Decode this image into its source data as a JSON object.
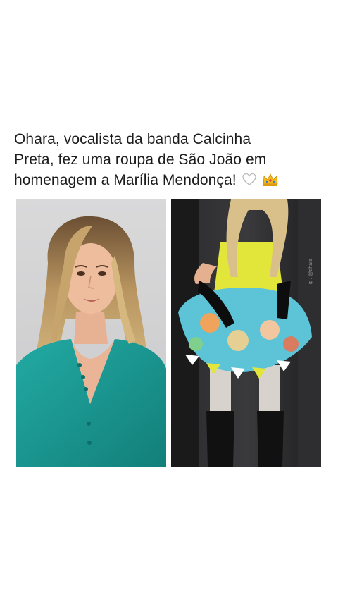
{
  "post": {
    "caption_line1": "Ohara, vocalista da banda Calcinha",
    "caption_line2": "Preta, fez uma roupa de São João em",
    "caption_line3": "homenagem a Marília Mendonça!",
    "caption_emojis": [
      "white-heart-icon",
      "crown-icon"
    ]
  },
  "images": [
    {
      "name": "portrait-photo",
      "icon": "person-photo"
    },
    {
      "name": "outfit-photo",
      "icon": "dress-photo"
    }
  ],
  "colors": {
    "background": "#ffffff",
    "text": "#1c1c1c",
    "teal_dress": "#1a9a95",
    "yellow_dress": "#e3e63a"
  }
}
